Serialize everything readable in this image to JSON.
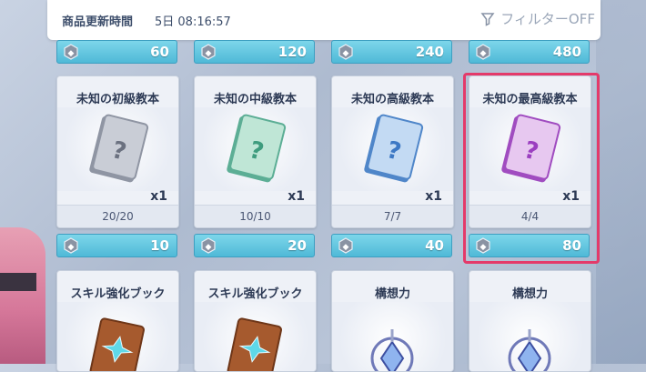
{
  "header": {
    "label": "商品更新時間",
    "time": "5日 08:16:57",
    "filter_label": "フィルターOFF"
  },
  "top_prices": [
    "60",
    "120",
    "240",
    "480"
  ],
  "items": [
    {
      "title": "未知の初級教本",
      "qty": "x1",
      "stock": "20/20",
      "price": "10",
      "book_color": "#c9cdd6",
      "book_dark": "#8f95a3",
      "q_color": "#6b7180"
    },
    {
      "title": "未知の中級教本",
      "qty": "x1",
      "stock": "10/10",
      "price": "20",
      "book_color": "#bfe6d6",
      "book_dark": "#5cae95",
      "q_color": "#3e9c7e"
    },
    {
      "title": "未知の高級教本",
      "qty": "x1",
      "stock": "7/7",
      "price": "40",
      "book_color": "#c3daf3",
      "book_dark": "#4f86c9",
      "q_color": "#3d78c4"
    },
    {
      "title": "未知の最高級教本",
      "qty": "x1",
      "stock": "4/4",
      "price": "80",
      "book_color": "#e7c8f0",
      "book_dark": "#a04cc0",
      "q_color": "#9b3fc0"
    }
  ],
  "bottom_items": [
    {
      "title": "スキル強化ブック"
    },
    {
      "title": "スキル強化ブック"
    },
    {
      "title": "構想力"
    },
    {
      "title": "構想力"
    }
  ],
  "colors": {
    "accent": "#4fb9d7",
    "highlight": "#e43a6a"
  },
  "icons": {
    "coin": "gem-coin-icon",
    "filter": "filter-funnel-icon"
  }
}
